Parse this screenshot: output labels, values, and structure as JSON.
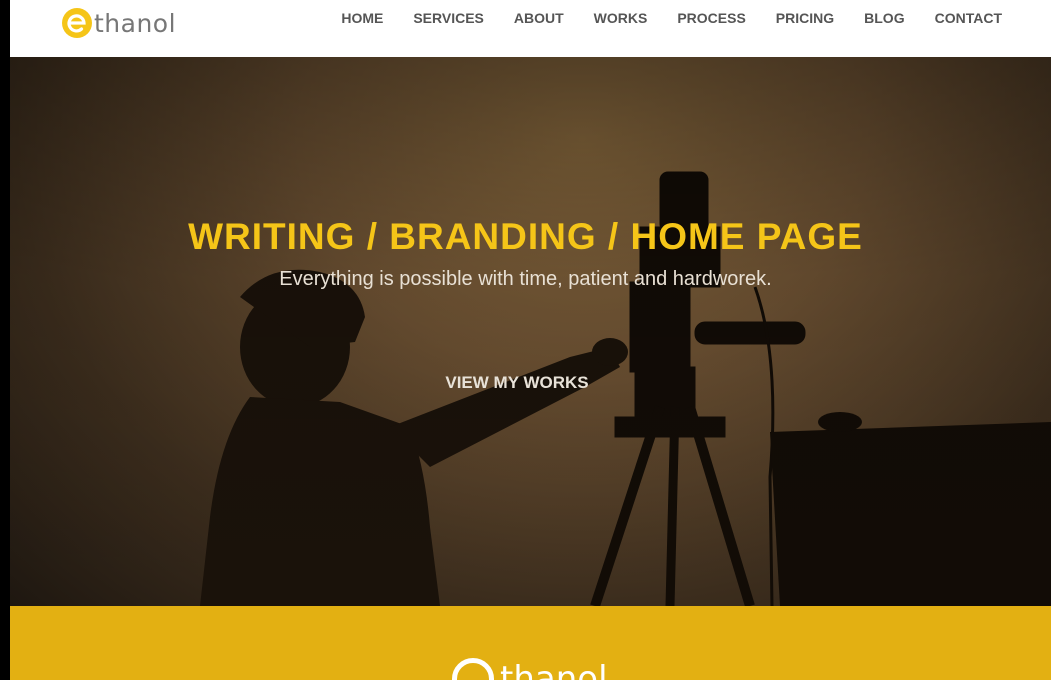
{
  "brand": {
    "name": "thanol",
    "accent_color": "#f5c518"
  },
  "nav": {
    "items": [
      {
        "label": "HOME"
      },
      {
        "label": "SERVICES"
      },
      {
        "label": "ABOUT"
      },
      {
        "label": "WORKS"
      },
      {
        "label": "PROCESS"
      },
      {
        "label": "PRICING"
      },
      {
        "label": "BLOG"
      },
      {
        "label": "CONTACT"
      }
    ]
  },
  "hero": {
    "title": "WRITING / BRANDING / HOME PAGE",
    "subtitle": "Everything is possible with time, patient and hardworek.",
    "cta_label": "VIEW MY WORKS",
    "image": "silhouette of a person operating a film camera on a tripod"
  },
  "footer": {
    "brand_name": "thanol",
    "background_color": "#e3b012"
  }
}
